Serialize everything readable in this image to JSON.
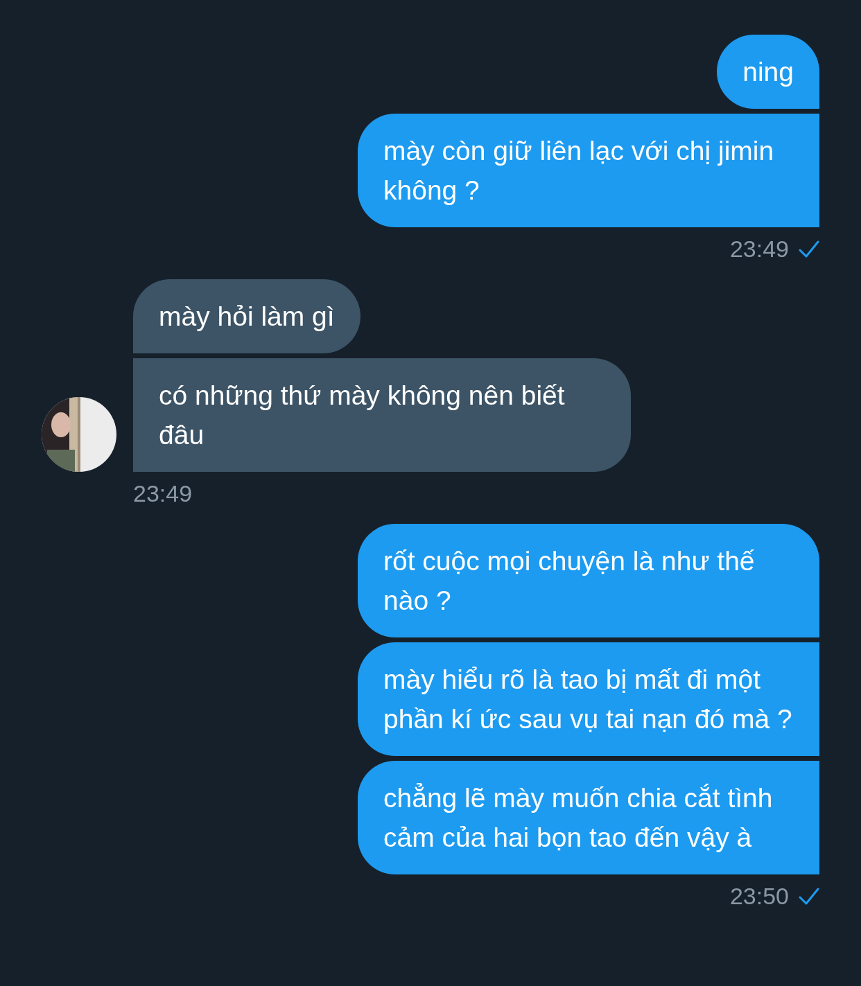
{
  "groups": [
    {
      "kind": "sent",
      "messages": [
        "ning",
        "mày còn giữ liên lạc với chị jimin không ?"
      ],
      "time": "23:49",
      "read": true
    },
    {
      "kind": "received",
      "avatar": {
        "kind": "picture"
      },
      "messages": [
        "mày hỏi làm gì",
        "có những thứ mày không nên biết đâu"
      ],
      "time": "23:49"
    },
    {
      "kind": "sent",
      "messages": [
        "rốt cuộc mọi chuyện là như thế nào ?",
        "mày hiểu rõ là tao bị mất đi một phần kí ức sau vụ tai nạn đó mà ?",
        "chẳng lẽ mày muốn chia cắt tình cảm của hai bọn tao đến vậy à"
      ],
      "time": "23:50",
      "read": true
    }
  ]
}
